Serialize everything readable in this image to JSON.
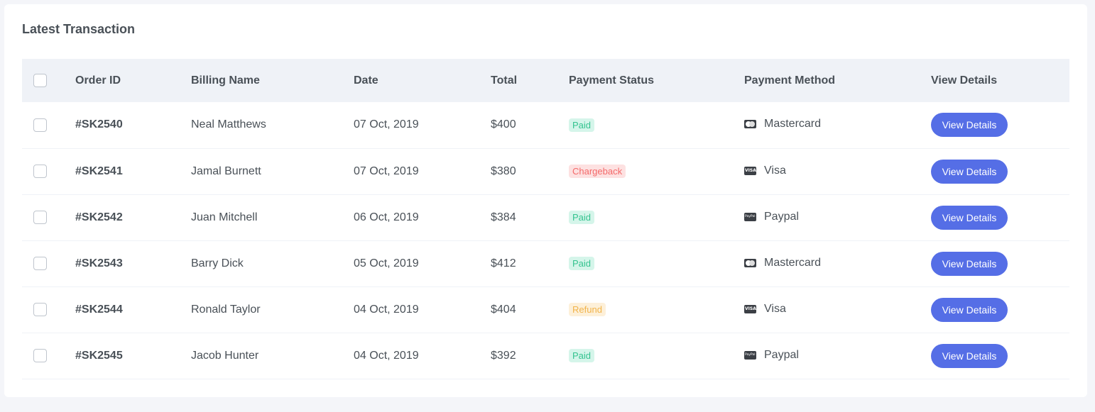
{
  "card": {
    "title": "Latest Transaction"
  },
  "table": {
    "headers": {
      "order_id": "Order ID",
      "billing_name": "Billing Name",
      "date": "Date",
      "total": "Total",
      "payment_status": "Payment Status",
      "payment_method": "Payment Method",
      "view_details": "View Details"
    },
    "rows": [
      {
        "order_id": "#SK2540",
        "billing_name": "Neal Matthews",
        "date": "07 Oct, 2019",
        "total": "$400",
        "status": "Paid",
        "status_type": "success",
        "method": "Mastercard",
        "method_icon": "mastercard-icon",
        "button": "View Details"
      },
      {
        "order_id": "#SK2541",
        "billing_name": "Jamal Burnett",
        "date": "07 Oct, 2019",
        "total": "$380",
        "status": "Chargeback",
        "status_type": "danger",
        "method": "Visa",
        "method_icon": "visa-icon",
        "button": "View Details"
      },
      {
        "order_id": "#SK2542",
        "billing_name": "Juan Mitchell",
        "date": "06 Oct, 2019",
        "total": "$384",
        "status": "Paid",
        "status_type": "success",
        "method": "Paypal",
        "method_icon": "paypal-icon",
        "button": "View Details"
      },
      {
        "order_id": "#SK2543",
        "billing_name": "Barry Dick",
        "date": "05 Oct, 2019",
        "total": "$412",
        "status": "Paid",
        "status_type": "success",
        "method": "Mastercard",
        "method_icon": "mastercard-icon",
        "button": "View Details"
      },
      {
        "order_id": "#SK2544",
        "billing_name": "Ronald Taylor",
        "date": "04 Oct, 2019",
        "total": "$404",
        "status": "Refund",
        "status_type": "warning",
        "method": "Visa",
        "method_icon": "visa-icon",
        "button": "View Details"
      },
      {
        "order_id": "#SK2545",
        "billing_name": "Jacob Hunter",
        "date": "04 Oct, 2019",
        "total": "$392",
        "status": "Paid",
        "status_type": "success",
        "method": "Paypal",
        "method_icon": "paypal-icon",
        "button": "View Details"
      }
    ]
  },
  "colors": {
    "primary": "#556ee6",
    "success": "#34c38f",
    "danger": "#f46a6a",
    "warning": "#f1b44c",
    "header_bg": "#eff2f7"
  }
}
